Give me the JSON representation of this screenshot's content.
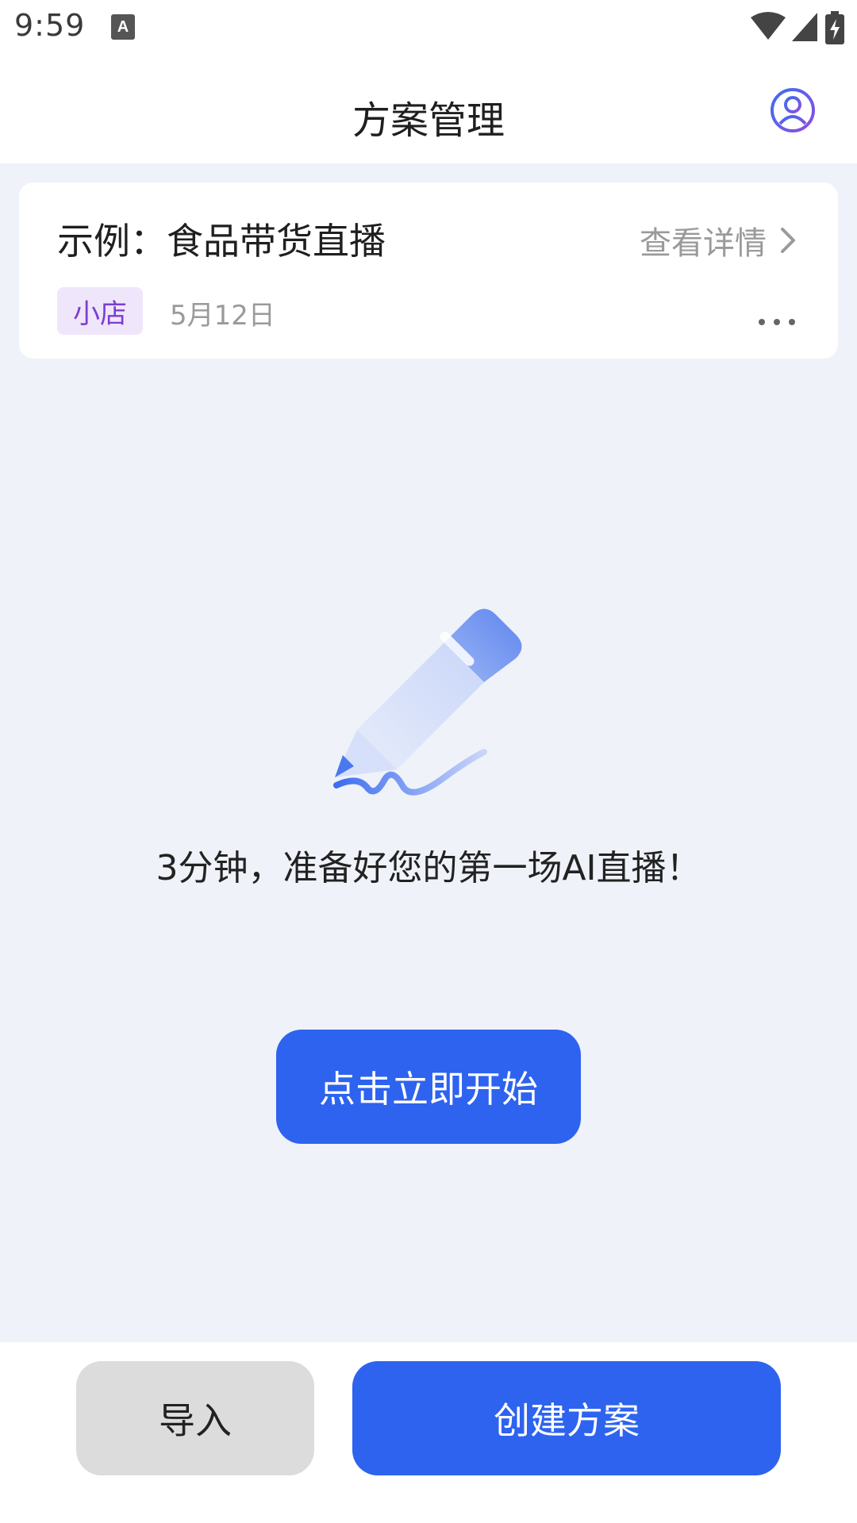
{
  "status_bar": {
    "time": "9:59",
    "icons": [
      "keyboard-a-icon",
      "wifi-icon",
      "signal-icon",
      "battery-charging-icon"
    ]
  },
  "header": {
    "title": "方案管理",
    "profile_icon": "user-profile-icon"
  },
  "plan_card": {
    "title": "示例：食品带货直播",
    "detail_link": "查看详情",
    "tag": "小店",
    "date": "5月12日",
    "more_icon": "more-dots-icon"
  },
  "empty_state": {
    "illustration": "pencil-icon",
    "message": "3分钟，准备好您的第一场AI直播！",
    "start_button": "点击立即开始"
  },
  "bottom_bar": {
    "import_label": "导入",
    "create_label": "创建方案"
  },
  "colors": {
    "accent": "#2d63ef",
    "background": "#eff2f8",
    "tag_bg": "#f0e6fb",
    "tag_text": "#7a3fd0",
    "secondary_button": "#dcdcdc"
  }
}
